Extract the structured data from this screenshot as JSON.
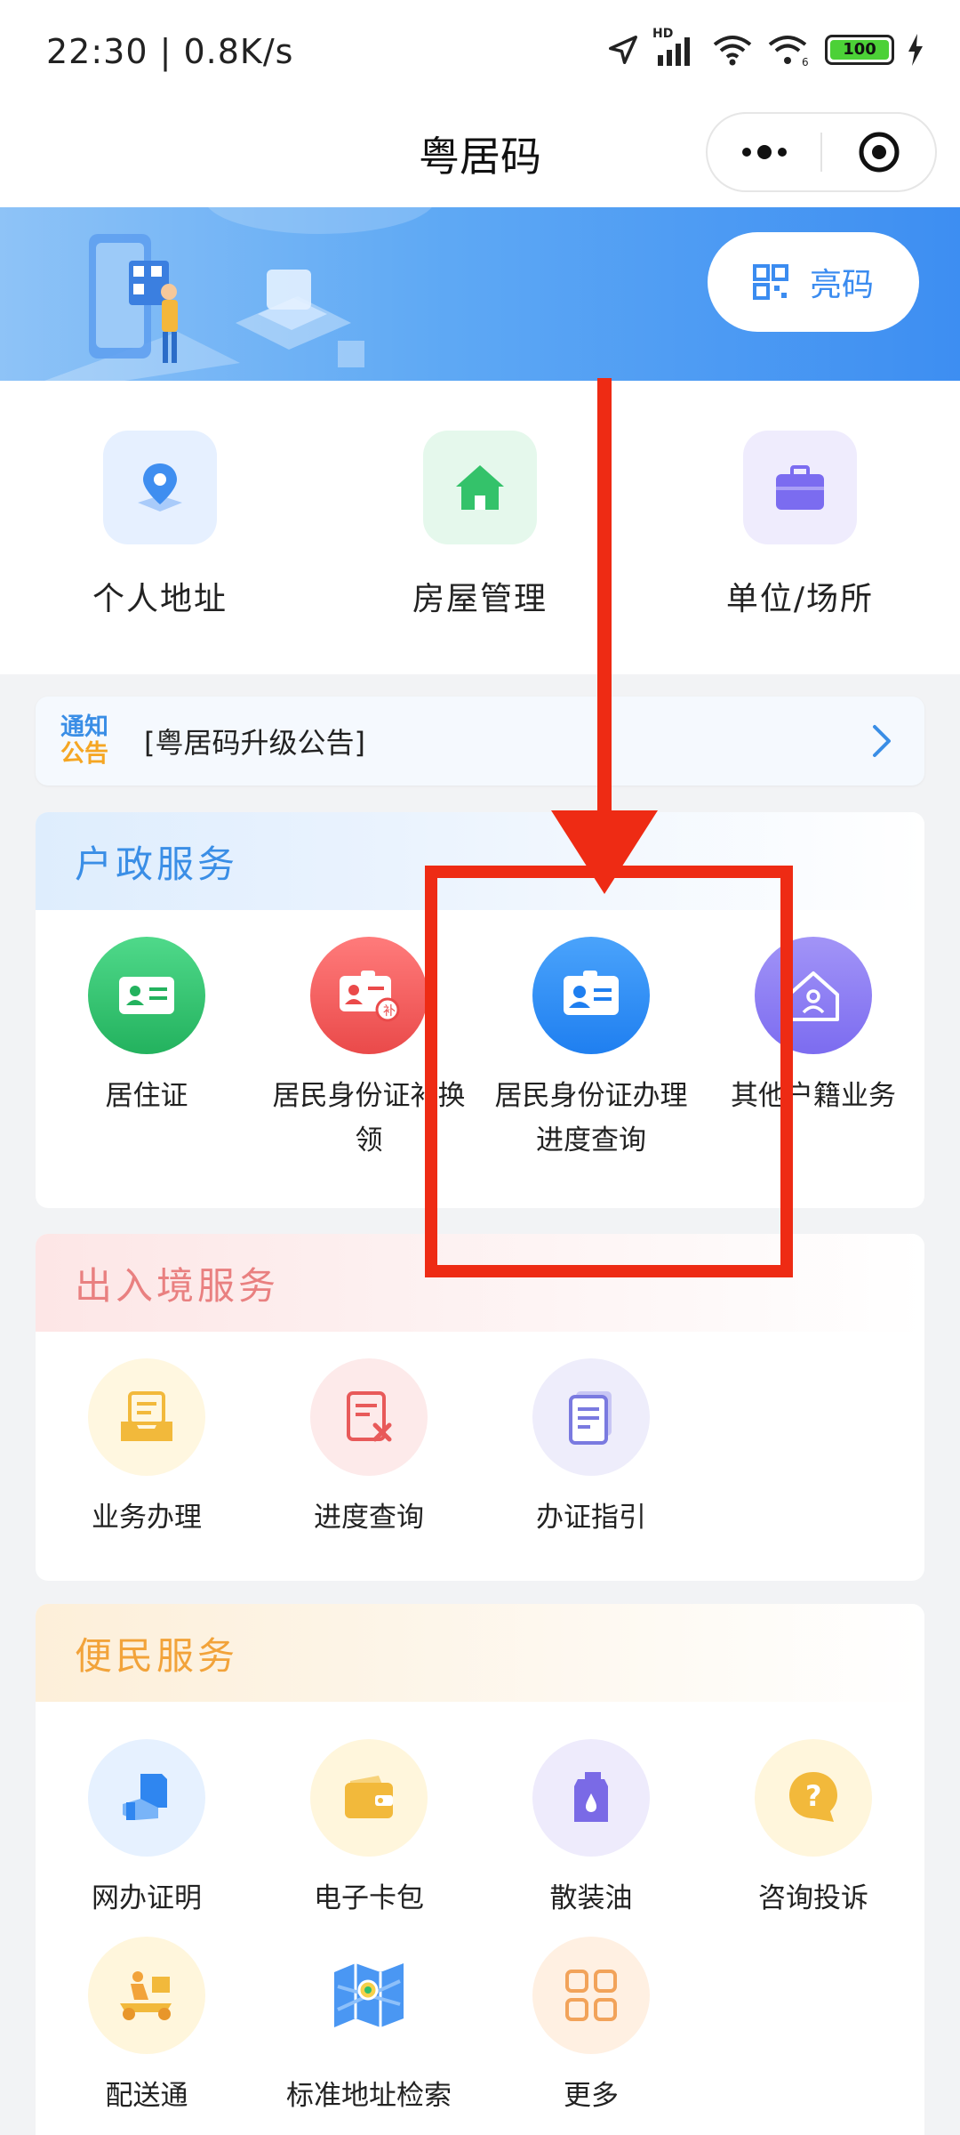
{
  "status_bar": {
    "time": "22:30 | 0.8K/s",
    "network_label": "HD",
    "battery": "100"
  },
  "nav": {
    "title": "粤居码"
  },
  "banner": {
    "button_label": "亮码"
  },
  "quick_entries": [
    {
      "label": "个人地址",
      "icon": "location-pin-icon",
      "bg": "#e6f0ff",
      "color": "#3f8ef0"
    },
    {
      "label": "房屋管理",
      "icon": "house-icon",
      "bg": "#e5f8ec",
      "color": "#34c26a"
    },
    {
      "label": "单位/场所",
      "icon": "briefcase-icon",
      "bg": "#efecfd",
      "color": "#7b6cf0"
    }
  ],
  "notice": {
    "tag_line1": "通知",
    "tag_line2": "公告",
    "text": "[粤居码升级公告]"
  },
  "household": {
    "title": "户政服务",
    "title_color": "#3a8ee6",
    "items": [
      {
        "label": "居住证",
        "icon": "residence-card-icon",
        "color": "#2fbf6c"
      },
      {
        "label": "居民身份证补换领",
        "icon": "id-card-replace-icon",
        "color": "#f05a5a"
      },
      {
        "label": "居民身份证办理进度查询",
        "icon": "id-card-progress-icon",
        "color": "#2f86f0"
      },
      {
        "label": "其他户籍业务",
        "icon": "household-registry-icon",
        "color": "#8a7cf2"
      }
    ]
  },
  "entry_exit": {
    "title": "出入境服务",
    "title_color": "#e98080",
    "items": [
      {
        "label": "业务办理",
        "icon": "inbox-tray-icon",
        "bg": "#fff7e0",
        "color": "#f2b93b"
      },
      {
        "label": "进度查询",
        "icon": "document-x-icon",
        "bg": "#fdeaea",
        "color": "#e85a5a"
      },
      {
        "label": "办证指引",
        "icon": "guide-document-icon",
        "bg": "#eeedfb",
        "color": "#7a7ae0"
      }
    ]
  },
  "convenience": {
    "title": "便民服务",
    "title_color": "#f2a33a",
    "items": [
      {
        "label": "网办证明",
        "icon": "certificate-hand-icon",
        "bg": "#e6f1ff",
        "color": "#2f86f0"
      },
      {
        "label": "电子卡包",
        "icon": "wallet-icon",
        "bg": "#fff6dc",
        "color": "#f2b93b"
      },
      {
        "label": "散装油",
        "icon": "oil-canister-icon",
        "bg": "#eeebfc",
        "color": "#7a6ae6"
      },
      {
        "label": "咨询投诉",
        "icon": "question-bubble-icon",
        "bg": "#fff6dc",
        "color": "#f2b93b"
      },
      {
        "label": "配送通",
        "icon": "delivery-scooter-icon",
        "bg": "#fff6dc",
        "color": "#f2b93b"
      },
      {
        "label": "标准地址检索",
        "icon": "map-search-icon",
        "bg": "#ffffff",
        "color": "#2f86f0"
      },
      {
        "label": "更多",
        "icon": "grid-more-icon",
        "bg": "#fff0e2",
        "color": "#f2a35a"
      }
    ]
  }
}
